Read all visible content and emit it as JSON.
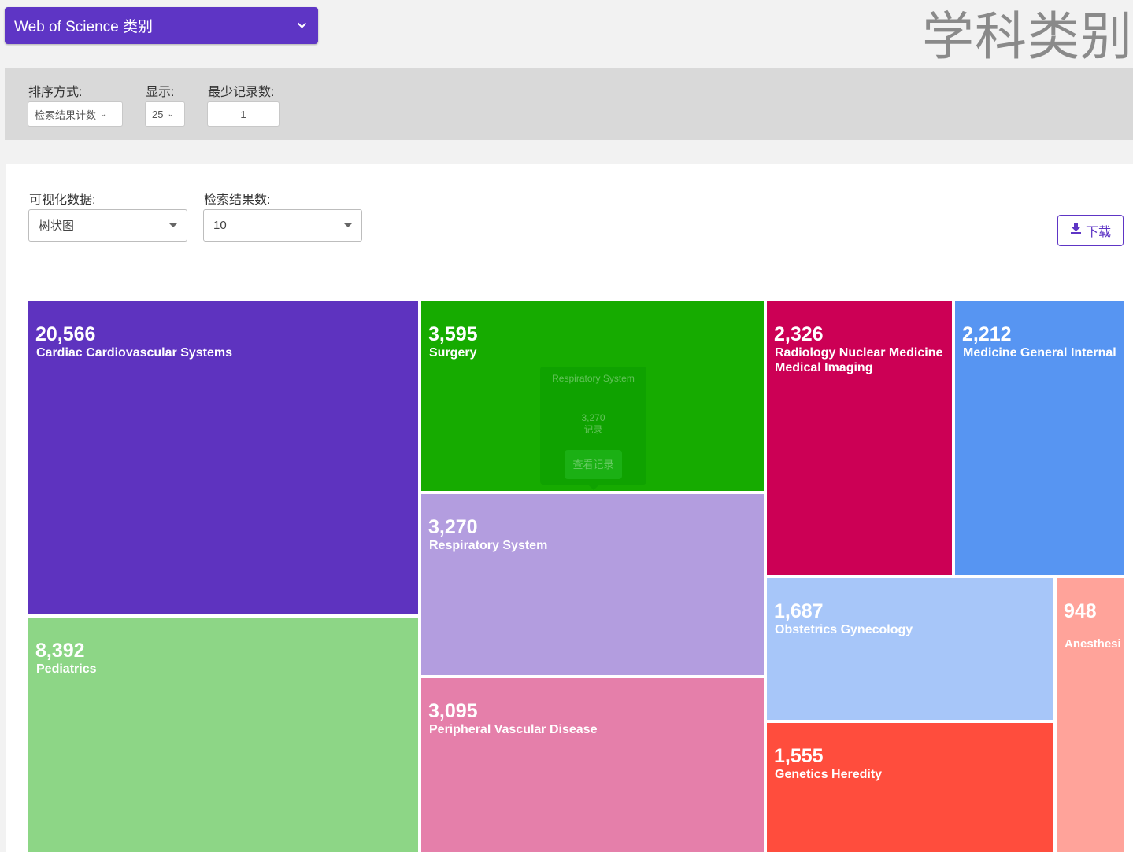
{
  "header": {
    "category_select_label": "Web of Science 类别",
    "page_title": "学科类别"
  },
  "filters": {
    "sort_label": "排序方式:",
    "sort_value": "检索结果计数",
    "show_label": "显示:",
    "show_value": "25",
    "min_records_label": "最少记录数:",
    "min_records_value": "1"
  },
  "visualization": {
    "data_label": "可视化数据:",
    "data_value": "树状图",
    "count_label": "检索结果数:",
    "count_value": "10",
    "download_label": "下载"
  },
  "chart_data": {
    "type": "treemap",
    "items": [
      {
        "label": "Cardiac Cardiovascular Systems",
        "value": 20566,
        "display": "20,566",
        "color": "#5e33bf"
      },
      {
        "label": "Pediatrics",
        "value": 8392,
        "display": "8,392",
        "color": "#8dd686"
      },
      {
        "label": "Surgery",
        "value": 3595,
        "display": "3,595",
        "color": "#16ab00"
      },
      {
        "label": "Respiratory System",
        "value": 3270,
        "display": "3,270",
        "color": "#b39ddf"
      },
      {
        "label": "Peripheral Vascular Disease",
        "value": 3095,
        "display": "3,095",
        "color": "#e57faa"
      },
      {
        "label": "Radiology Nuclear Medicine Medical Imaging",
        "value": 2326,
        "display": "2,326",
        "color": "#cc0055"
      },
      {
        "label": "Medicine General Internal",
        "value": 2212,
        "display": "2,212",
        "color": "#5795f2"
      },
      {
        "label": "Obstetrics Gynecology",
        "value": 1687,
        "display": "1,687",
        "color": "#a7c6f9"
      },
      {
        "label": "Genetics Heredity",
        "value": 1555,
        "display": "1,555",
        "color": "#ff4d3d"
      },
      {
        "label": "Anesthesi",
        "value": 948,
        "display": "948",
        "color": "#ffa39a"
      }
    ]
  },
  "tooltip": {
    "title": "Respiratory System",
    "count": "3,270",
    "records_word": "记录",
    "button_label": "查看记录"
  }
}
